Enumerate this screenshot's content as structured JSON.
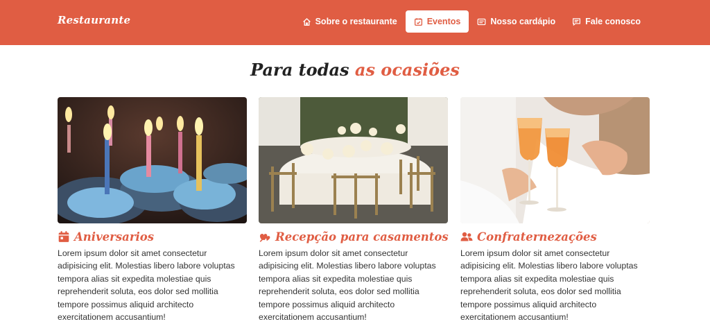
{
  "brand": "Restaurante",
  "nav": {
    "items": [
      {
        "label": "Sobre o restaurante",
        "icon": "home-icon"
      },
      {
        "label": "Eventos",
        "icon": "calendar-icon",
        "active": true
      },
      {
        "label": "Nosso cardápio",
        "icon": "menu-card-icon"
      },
      {
        "label": "Fale conosco",
        "icon": "chat-icon"
      }
    ]
  },
  "heading": {
    "part1": "Para todas ",
    "part2": "as ocasiões"
  },
  "cards": [
    {
      "title": "Aniversarios",
      "icon": "calendar-day-icon",
      "text": "Lorem ipsum dolor sit amet consectetur adipisicing elit. Molestias libero labore voluptas tempora alias sit expedita molestiae quis reprehenderit soluta, eos dolor sed mollitia tempore possimus aliquid architecto exercitationem accusantium!"
    },
    {
      "title": "Recepção para casamentos",
      "icon": "hearts-icon",
      "text": "Lorem ipsum dolor sit amet consectetur adipisicing elit. Molestias libero labore voluptas tempora alias sit expedita molestiae quis reprehenderit soluta, eos dolor sed mollitia tempore possimus aliquid architecto exercitationem accusantium!"
    },
    {
      "title": "Confraternezações",
      "icon": "users-icon",
      "text": "Lorem ipsum dolor sit amet consectetur adipisicing elit. Molestias libero labore voluptas tempora alias sit expedita molestiae quis reprehenderit soluta, eos dolor sed mollitia tempore possimus aliquid architecto exercitationem accusantium!"
    }
  ],
  "colors": {
    "accent": "#e05d43",
    "text": "#333333",
    "heading": "#222222"
  }
}
